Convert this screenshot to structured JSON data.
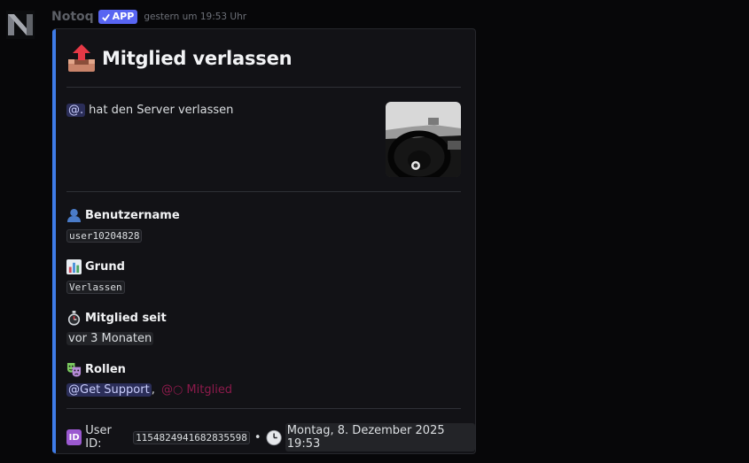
{
  "message": {
    "username": "Notoq",
    "app_badge": "APP",
    "timestamp": "gestern um 19:53 Uhr",
    "avatar_icon": "letter-n-logo"
  },
  "embed": {
    "accent_color": "#3f7ce8",
    "title_icon": "outbox-tray-icon",
    "title": "Mitglied verlassen",
    "description": {
      "mention": "@.",
      "text": "hat den Server verlassen"
    },
    "thumbnail_icon": "car-steering-wheel-photo",
    "fields": [
      {
        "icon": "bust-silhouette-icon",
        "name": "Benutzername",
        "value": "user10204828"
      },
      {
        "icon": "bar-chart-icon",
        "name": "Grund",
        "value": "Verlassen"
      },
      {
        "icon": "stopwatch-icon",
        "name": "Mitglied seit",
        "value": "vor 3 Monaten"
      },
      {
        "icon": "theater-masks-icon",
        "name": "Rollen",
        "roles": [
          "@Get Support",
          "@○ Mitglied"
        ],
        "separator": ","
      }
    ],
    "footer": {
      "id_badge": "ID",
      "label": "User ID:",
      "user_id": "1154824941682835598",
      "dot": "•",
      "clock_icon": "clock-icon",
      "date": "Montag, 8. Dezember 2025 19:53"
    }
  }
}
